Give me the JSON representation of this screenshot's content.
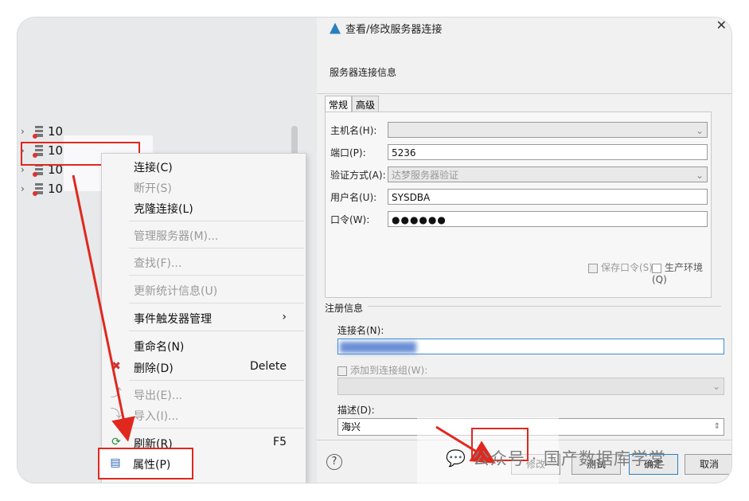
{
  "tree": {
    "items": [
      {
        "label": "10"
      },
      {
        "label": "10"
      },
      {
        "label": "10"
      },
      {
        "label": "10"
      }
    ]
  },
  "context_menu": {
    "items": [
      {
        "label": "连接(C)",
        "key": "",
        "disabled": false
      },
      {
        "label": "断开(S)",
        "key": "",
        "disabled": true
      },
      {
        "label": "克隆连接(L)",
        "key": "",
        "disabled": false
      },
      {
        "label": "管理服务器(M)...",
        "key": "",
        "disabled": true
      },
      {
        "label": "查找(F)...",
        "key": "",
        "disabled": true
      },
      {
        "label": "更新统计信息(U)",
        "key": "",
        "disabled": true
      },
      {
        "label": "事件触发器管理",
        "key": "›",
        "disabled": false
      },
      {
        "label": "重命名(N)",
        "key": "",
        "disabled": false
      },
      {
        "label": "删除(D)",
        "key": "Delete",
        "disabled": false
      },
      {
        "label": "导出(E)...",
        "key": "",
        "disabled": true
      },
      {
        "label": "导入(I)...",
        "key": "",
        "disabled": true
      },
      {
        "label": "刷新(R)",
        "key": "F5",
        "disabled": false
      },
      {
        "label": "属性(P)",
        "key": "",
        "disabled": false
      }
    ]
  },
  "dialog": {
    "title": "查看/修改服务器连接",
    "subtitle": "服务器连接信息",
    "tabs": [
      "常规",
      "高级"
    ],
    "fields": {
      "host_label": "主机名(H):",
      "host_value": "",
      "port_label": "端口(P):",
      "port_value": "5236",
      "auth_label": "验证方式(A):",
      "auth_value": "达梦服务器验证",
      "user_label": "用户名(U):",
      "user_value": "SYSDBA",
      "pwd_label": "口令(W):",
      "pwd_value": "●●●●●●",
      "save_pwd": "保存口令(S)",
      "prod_env": "生产环境(Q)"
    },
    "register": {
      "title": "注册信息",
      "conn_name_label": "连接名(N):",
      "conn_name_value": "",
      "add_group_label": "添加到连接组(W):",
      "desc_label": "描述(D):",
      "desc_value": "海兴"
    },
    "buttons": {
      "help": "?",
      "modify": "修改",
      "test": "测试",
      "confirm": "确定",
      "cancel": "取消"
    }
  },
  "watermark": {
    "text": "公众号 · 国产数据库学堂"
  },
  "colors": {
    "highlight": "#e0281e",
    "accent": "#2a7fc1"
  }
}
